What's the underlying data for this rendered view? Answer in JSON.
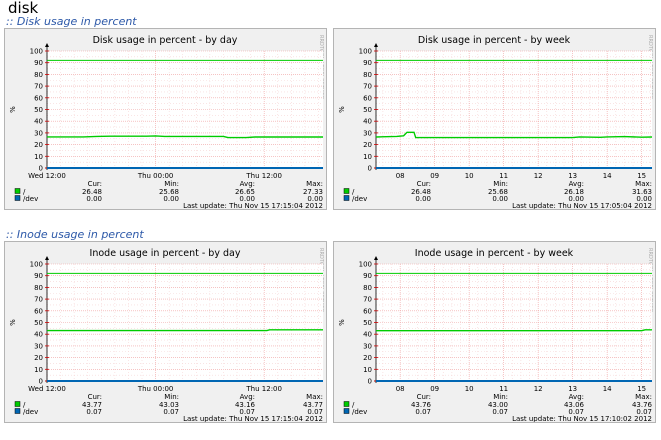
{
  "page": {
    "title": "disk"
  },
  "sections": [
    {
      "title": ":: Disk usage in percent",
      "graphs": [
        {
          "title": "Disk usage in percent - by day",
          "ylabel": "%",
          "side_label": "RRDTOOL / TOBI OETIKER",
          "footer": "Munin 1.4.7",
          "last_update": "Last update: Thu Nov 15 17:15:04 2012",
          "stats_headers": [
            "Cur:",
            "Min:",
            "Avg:",
            "Max:"
          ],
          "legend": [
            {
              "name": "/",
              "color": "#00cc00",
              "values": [
                "26.48",
                "25.68",
                "26.65",
                "27.33"
              ]
            },
            {
              "name": "/dev",
              "color": "#0066b3",
              "values": [
                "0.00",
                "0.00",
                "0.00",
                "0.00"
              ]
            }
          ]
        },
        {
          "title": "Disk usage in percent - by week",
          "ylabel": "%",
          "side_label": "RRDTOOL / TOBI OETIKER",
          "footer": "Munin 1.4.7",
          "last_update": "Last update: Thu Nov 15 17:05:04 2012",
          "stats_headers": [
            "Cur:",
            "Min:",
            "Avg:",
            "Max:"
          ],
          "legend": [
            {
              "name": "/",
              "color": "#00cc00",
              "values": [
                "26.48",
                "25.68",
                "26.18",
                "31.63"
              ]
            },
            {
              "name": "/dev",
              "color": "#0066b3",
              "values": [
                "0.00",
                "0.00",
                "0.00",
                "0.00"
              ]
            }
          ]
        }
      ]
    },
    {
      "title": ":: Inode usage in percent",
      "graphs": [
        {
          "title": "Inode usage in percent - by day",
          "ylabel": "%",
          "side_label": "RRDTOOL / TOBI OETIKER",
          "footer": "Munin 1.4.7",
          "last_update": "Last update: Thu Nov 15 17:15:04 2012",
          "stats_headers": [
            "Cur:",
            "Min:",
            "Avg:",
            "Max:"
          ],
          "legend": [
            {
              "name": "/",
              "color": "#00cc00",
              "values": [
                "43.77",
                "43.03",
                "43.16",
                "43.77"
              ]
            },
            {
              "name": "/dev",
              "color": "#0066b3",
              "values": [
                "0.07",
                "0.07",
                "0.07",
                "0.07"
              ]
            }
          ]
        },
        {
          "title": "Inode usage in percent - by week",
          "ylabel": "%",
          "side_label": "RRDTOOL / TOBI OETIKER",
          "footer": "Munin 1.4.7",
          "last_update": "Last update: Thu Nov 15 17:10:02 2012",
          "stats_headers": [
            "Cur:",
            "Min:",
            "Avg:",
            "Max:"
          ],
          "legend": [
            {
              "name": "/",
              "color": "#00cc00",
              "values": [
                "43.76",
                "43.00",
                "43.06",
                "43.76"
              ]
            },
            {
              "name": "/dev",
              "color": "#0066b3",
              "values": [
                "0.07",
                "0.07",
                "0.07",
                "0.07"
              ]
            }
          ]
        }
      ]
    }
  ],
  "chart_data": [
    {
      "type": "line",
      "title": "Disk usage in percent - by day",
      "ylabel": "%",
      "ylim": [
        0,
        100
      ],
      "yticks": [
        0,
        10,
        20,
        30,
        40,
        50,
        60,
        70,
        80,
        90,
        100
      ],
      "xlim": [
        0,
        30.5
      ],
      "xticks": [
        {
          "label": "Wed 12:00",
          "x": 0
        },
        {
          "label": "Thu 00:00",
          "x": 12
        },
        {
          "label": "Thu 12:00",
          "x": 24
        }
      ],
      "grid": true,
      "threshold_lines": [
        {
          "y": 92,
          "color": "#00cc00"
        }
      ],
      "series": [
        {
          "name": "/",
          "color": "#00cc00",
          "points": [
            [
              0,
              26.6
            ],
            [
              4,
              26.6
            ],
            [
              5.5,
              27.0
            ],
            [
              7,
              27.2
            ],
            [
              11,
              27.2
            ],
            [
              12,
              27.4
            ],
            [
              13,
              27.0
            ],
            [
              18,
              27.0
            ],
            [
              19.5,
              27.0
            ],
            [
              20,
              26.0
            ],
            [
              22,
              26.0
            ],
            [
              23,
              26.5
            ],
            [
              30.5,
              26.5
            ]
          ]
        },
        {
          "name": "/dev",
          "color": "#0066b3",
          "points": [
            [
              0,
              0
            ],
            [
              30.5,
              0
            ]
          ]
        }
      ]
    },
    {
      "type": "line",
      "title": "Disk usage in percent - by week",
      "ylabel": "%",
      "ylim": [
        0,
        100
      ],
      "yticks": [
        0,
        10,
        20,
        30,
        40,
        50,
        60,
        70,
        80,
        90,
        100
      ],
      "xlim": [
        7.3,
        15.3
      ],
      "xticks": [
        {
          "label": "08",
          "x": 8
        },
        {
          "label": "09",
          "x": 9
        },
        {
          "label": "10",
          "x": 10
        },
        {
          "label": "11",
          "x": 11
        },
        {
          "label": "12",
          "x": 12
        },
        {
          "label": "13",
          "x": 13
        },
        {
          "label": "14",
          "x": 14
        },
        {
          "label": "15",
          "x": 15
        }
      ],
      "grid": true,
      "threshold_lines": [
        {
          "y": 92,
          "color": "#00cc00"
        }
      ],
      "series": [
        {
          "name": "/",
          "color": "#00cc00",
          "points": [
            [
              7.3,
              26.5
            ],
            [
              7.9,
              27.0
            ],
            [
              8.1,
              27.5
            ],
            [
              8.2,
              30.5
            ],
            [
              8.4,
              30.5
            ],
            [
              8.45,
              26.0
            ],
            [
              9,
              26.0
            ],
            [
              13,
              26.0
            ],
            [
              13.2,
              26.6
            ],
            [
              13.8,
              26.2
            ],
            [
              14.0,
              26.6
            ],
            [
              14.5,
              26.8
            ],
            [
              15.0,
              26.3
            ],
            [
              15.3,
              26.5
            ]
          ]
        },
        {
          "name": "/dev",
          "color": "#0066b3",
          "points": [
            [
              7.3,
              0
            ],
            [
              15.3,
              0
            ]
          ]
        }
      ]
    },
    {
      "type": "line",
      "title": "Inode usage in percent - by day",
      "ylabel": "%",
      "ylim": [
        0,
        100
      ],
      "yticks": [
        0,
        10,
        20,
        30,
        40,
        50,
        60,
        70,
        80,
        90,
        100
      ],
      "xlim": [
        0,
        30.5
      ],
      "xticks": [
        {
          "label": "Wed 12:00",
          "x": 0
        },
        {
          "label": "Thu 00:00",
          "x": 12
        },
        {
          "label": "Thu 12:00",
          "x": 24
        }
      ],
      "grid": true,
      "threshold_lines": [
        {
          "y": 92,
          "color": "#00cc00"
        }
      ],
      "series": [
        {
          "name": "/",
          "color": "#00cc00",
          "points": [
            [
              0,
              43.1
            ],
            [
              24.3,
              43.1
            ],
            [
              24.6,
              43.8
            ],
            [
              30.5,
              43.8
            ]
          ]
        },
        {
          "name": "/dev",
          "color": "#0066b3",
          "points": [
            [
              0,
              0
            ],
            [
              30.5,
              0
            ]
          ]
        }
      ]
    },
    {
      "type": "line",
      "title": "Inode usage in percent - by week",
      "ylabel": "%",
      "ylim": [
        0,
        100
      ],
      "yticks": [
        0,
        10,
        20,
        30,
        40,
        50,
        60,
        70,
        80,
        90,
        100
      ],
      "xlim": [
        7.3,
        15.3
      ],
      "xticks": [
        {
          "label": "08",
          "x": 8
        },
        {
          "label": "09",
          "x": 9
        },
        {
          "label": "10",
          "x": 10
        },
        {
          "label": "11",
          "x": 11
        },
        {
          "label": "12",
          "x": 12
        },
        {
          "label": "13",
          "x": 13
        },
        {
          "label": "14",
          "x": 14
        },
        {
          "label": "15",
          "x": 15
        }
      ],
      "grid": true,
      "threshold_lines": [
        {
          "y": 92,
          "color": "#00cc00"
        }
      ],
      "series": [
        {
          "name": "/",
          "color": "#00cc00",
          "points": [
            [
              7.3,
              43.0
            ],
            [
              15.0,
              43.0
            ],
            [
              15.1,
              43.8
            ],
            [
              15.3,
              43.8
            ]
          ]
        },
        {
          "name": "/dev",
          "color": "#0066b3",
          "points": [
            [
              7.3,
              0
            ],
            [
              15.3,
              0
            ]
          ]
        }
      ]
    }
  ]
}
